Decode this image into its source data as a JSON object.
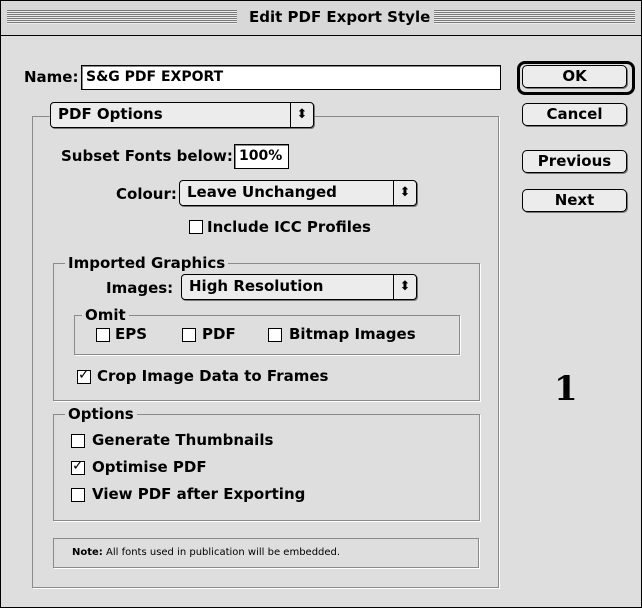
{
  "window": {
    "title": "Edit PDF Export Style"
  },
  "name_field": {
    "label": "Name:",
    "value": "S&G PDF EXPORT"
  },
  "buttons": {
    "ok": "OK",
    "cancel": "Cancel",
    "previous": "Previous",
    "next": "Next"
  },
  "section_popup": {
    "value": "PDF Options"
  },
  "subset_fonts": {
    "label": "Subset Fonts below:",
    "value": "100%"
  },
  "colour": {
    "label": "Colour:",
    "value": "Leave Unchanged"
  },
  "include_icc": {
    "label": "Include ICC Profiles",
    "checked": false
  },
  "imported_graphics": {
    "title": "Imported Graphics",
    "images_label": "Images:",
    "images_value": "High Resolution",
    "omit": {
      "title": "Omit",
      "eps": {
        "label": "EPS",
        "checked": false
      },
      "pdf": {
        "label": "PDF",
        "checked": false
      },
      "bitmap": {
        "label": "Bitmap Images",
        "checked": false
      }
    },
    "crop": {
      "label": "Crop Image Data to Frames",
      "checked": true
    }
  },
  "options": {
    "title": "Options",
    "thumbnails": {
      "label": "Generate Thumbnails",
      "checked": false
    },
    "optimise": {
      "label": "Optimise PDF",
      "checked": true
    },
    "view_after": {
      "label": "View PDF after Exporting",
      "checked": false
    }
  },
  "note": {
    "prefix": "Note:",
    "text": " All fonts used in publication will be embedded."
  },
  "figure_number": "1",
  "icons": {
    "popup_arrow": "up-down-arrows-icon",
    "checkmark": "checkmark-icon"
  },
  "colors": {
    "window_bg": "#dedede",
    "field_bg": "#ffffff"
  }
}
